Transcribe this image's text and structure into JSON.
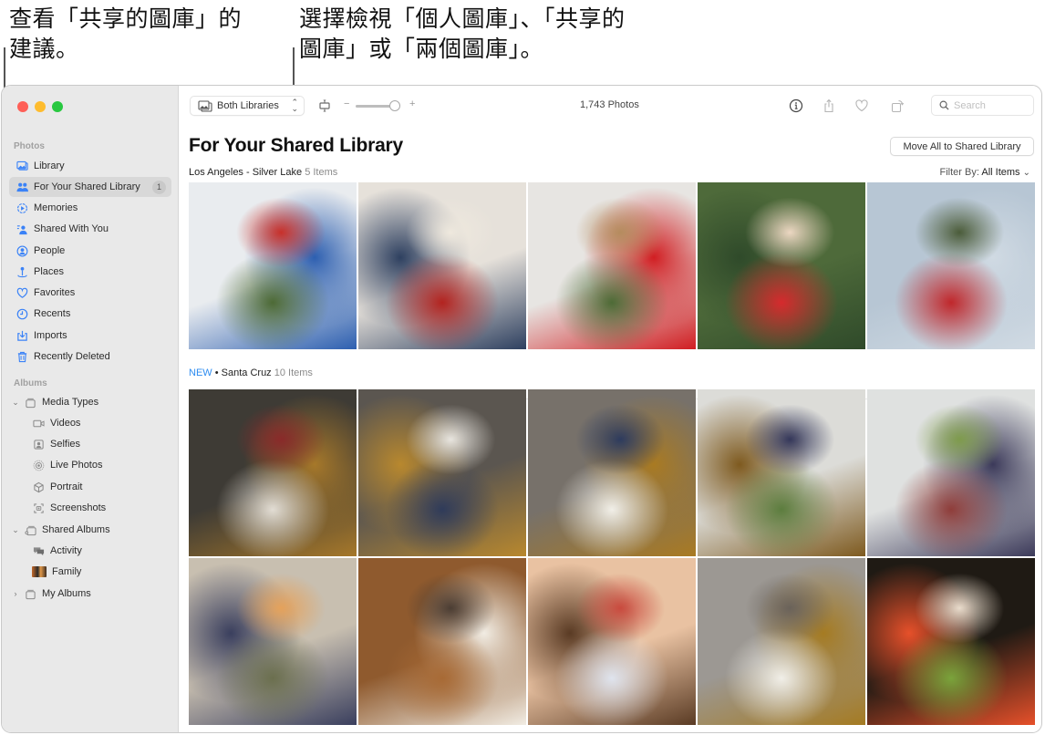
{
  "callouts": {
    "left": "查看「共享的圖庫」的\n建議。",
    "right": "選擇檢視「個人圖庫」、「共享的\n圖庫」或「兩個圖庫」。"
  },
  "sidebar": {
    "photos_header": "Photos",
    "items": [
      {
        "label": "Library",
        "icon": "library-icon"
      },
      {
        "label": "For Your Shared Library",
        "icon": "shared-library-people-icon",
        "badge": "1",
        "selected": true
      },
      {
        "label": "Memories",
        "icon": "memories-icon"
      },
      {
        "label": "Shared With You",
        "icon": "shared-with-you-icon"
      },
      {
        "label": "People",
        "icon": "people-icon"
      },
      {
        "label": "Places",
        "icon": "places-pin-icon"
      },
      {
        "label": "Favorites",
        "icon": "heart-icon"
      },
      {
        "label": "Recents",
        "icon": "clock-icon"
      },
      {
        "label": "Imports",
        "icon": "import-icon"
      },
      {
        "label": "Recently Deleted",
        "icon": "trash-icon"
      }
    ],
    "albums_header": "Albums",
    "albums": [
      {
        "label": "Media Types",
        "icon": "folder-stack-icon",
        "expanded": true
      },
      {
        "label": "Videos",
        "icon": "video-icon"
      },
      {
        "label": "Selfies",
        "icon": "selfie-icon"
      },
      {
        "label": "Live Photos",
        "icon": "live-photo-icon"
      },
      {
        "label": "Portrait",
        "icon": "portrait-cube-icon"
      },
      {
        "label": "Screenshots",
        "icon": "screenshot-icon"
      },
      {
        "label": "Shared Albums",
        "icon": "shared-album-stack-icon",
        "expanded": true
      },
      {
        "label": "Activity",
        "icon": "activity-bubbles-icon"
      },
      {
        "label": "Family",
        "icon": "family-thumbnail"
      },
      {
        "label": "My Albums",
        "icon": "folder-stack-icon",
        "expanded": false
      }
    ]
  },
  "toolbar": {
    "library_selector": "Both Libraries",
    "photo_count": "1,743 Photos",
    "search_placeholder": "Search",
    "zoom_minus": "−",
    "zoom_plus": "+",
    "zoom_level": 0.9
  },
  "content": {
    "title": "For Your Shared Library",
    "move_all_button": "Move All to Shared Library",
    "filter_label": "Filter By:",
    "filter_value": "All Items",
    "sections": [
      {
        "name": "Los Angeles - Silver Lake",
        "count": "5 Items",
        "new": false,
        "photos": [
          {
            "desc": "Child behind blue window",
            "colors": [
              "#e9ecef",
              "#2d5fb0",
              "#4d6a35",
              "#c8302a"
            ]
          },
          {
            "desc": "Two kids on couch",
            "colors": [
              "#e6e1da",
              "#2e4060",
              "#b3231f",
              "#efe9de"
            ]
          },
          {
            "desc": "Kid playing ukulele",
            "colors": [
              "#e7e5e2",
              "#d11e22",
              "#4d6b36",
              "#b58c5e"
            ]
          },
          {
            "desc": "Smiling kid in red overalls outdoors",
            "colors": [
              "#4e6a3a",
              "#2f4a2a",
              "#d62a2d",
              "#ecd7c2"
            ]
          },
          {
            "desc": "Kid with megaphone",
            "colors": [
              "#b7c6d4",
              "#d0dae3",
              "#c0272b",
              "#4b5c3a"
            ]
          }
        ]
      },
      {
        "name": "Santa Cruz",
        "count": "10 Items",
        "new": true,
        "new_label": "NEW",
        "photos": [
          {
            "desc": "Baking with plants",
            "colors": [
              "#3e3b35",
              "#a6782a",
              "#e2ddd4",
              "#8a2a2a"
            ]
          },
          {
            "desc": "Woman and striped-shirt child",
            "colors": [
              "#5b5650",
              "#b8882e",
              "#2f3b5a",
              "#e8e5df"
            ]
          },
          {
            "desc": "Smiling woman baking",
            "colors": [
              "#77716a",
              "#a97a22",
              "#f1efe8",
              "#2d3b5e"
            ]
          },
          {
            "desc": "Kids at window table",
            "colors": [
              "#dcdcd8",
              "#7e5a1f",
              "#5c7d3e",
              "#34375a"
            ]
          },
          {
            "desc": "Boy with striped shirt by garden",
            "colors": [
              "#dfe1e0",
              "#3c3a5a",
              "#8f3d3a",
              "#7e9b4c"
            ]
          },
          {
            "desc": "Child eating fruit",
            "colors": [
              "#c8bfb0",
              "#3a3f5e",
              "#6b6f4e",
              "#e5a25b"
            ]
          },
          {
            "desc": "Flour on wooden table",
            "colors": [
              "#8f5a2e",
              "#f1ece3",
              "#a86a35",
              "#4b3d33"
            ]
          },
          {
            "desc": "Kid with floury face",
            "colors": [
              "#e9c2a2",
              "#5a3b24",
              "#dfe4ee",
              "#c94a3e"
            ]
          },
          {
            "desc": "Smiling woman with towel",
            "colors": [
              "#9c9893",
              "#a57b22",
              "#f1efe8",
              "#6a625a"
            ]
          },
          {
            "desc": "Toddler and tulips",
            "colors": [
              "#1f1a14",
              "#e6502a",
              "#7aa33b",
              "#e9dccc"
            ]
          }
        ]
      }
    ]
  }
}
